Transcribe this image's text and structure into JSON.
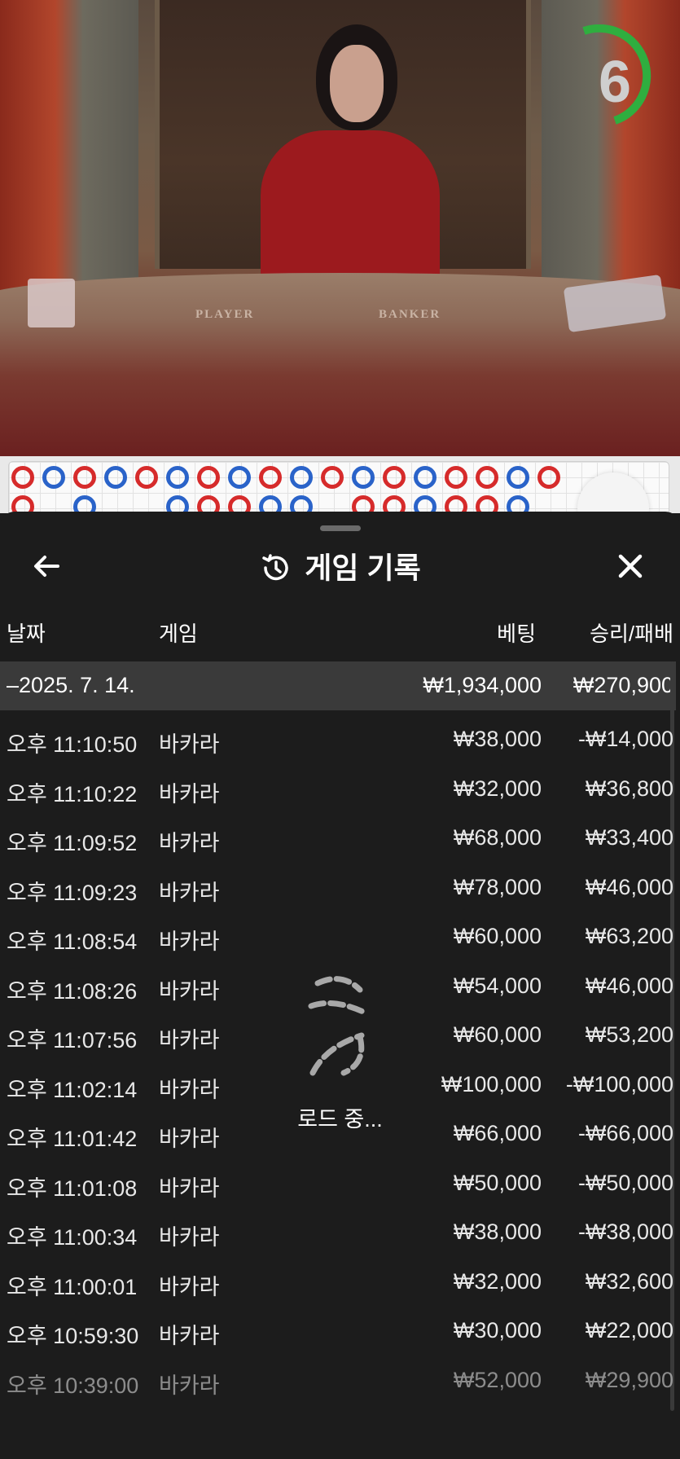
{
  "video": {
    "timer_value": "6",
    "table_labels": [
      "PLAYER",
      "BANKER"
    ]
  },
  "sheet": {
    "title": "게임 기록",
    "columns": {
      "date": "날짜",
      "game": "게임",
      "bet": "베팅",
      "win_loss": "승리/패배"
    },
    "day_summary": {
      "date": "–2025. 7. 14.",
      "bet": "₩1,934,000",
      "win_loss": "₩270,900"
    },
    "rows": [
      {
        "time": "오후 11:10:50",
        "game": "바카라",
        "bet": "₩38,000",
        "win": "-₩14,000"
      },
      {
        "time": "오후 11:10:22",
        "game": "바카라",
        "bet": "₩32,000",
        "win": "₩36,800"
      },
      {
        "time": "오후 11:09:52",
        "game": "바카라",
        "bet": "₩68,000",
        "win": "₩33,400"
      },
      {
        "time": "오후 11:09:23",
        "game": "바카라",
        "bet": "₩78,000",
        "win": "₩46,000"
      },
      {
        "time": "오후 11:08:54",
        "game": "바카라",
        "bet": "₩60,000",
        "win": "₩63,200"
      },
      {
        "time": "오후 11:08:26",
        "game": "바카라",
        "bet": "₩54,000",
        "win": "₩46,000"
      },
      {
        "time": "오후 11:07:56",
        "game": "바카라",
        "bet": "₩60,000",
        "win": "₩53,200"
      },
      {
        "time": "오후 11:02:14",
        "game": "바카라",
        "bet": "₩100,000",
        "win": "-₩100,000"
      },
      {
        "time": "오후 11:01:42",
        "game": "바카라",
        "bet": "₩66,000",
        "win": "-₩66,000"
      },
      {
        "time": "오후 11:01:08",
        "game": "바카라",
        "bet": "₩50,000",
        "win": "-₩50,000"
      },
      {
        "time": "오후 11:00:34",
        "game": "바카라",
        "bet": "₩38,000",
        "win": "-₩38,000"
      },
      {
        "time": "오후 11:00:01",
        "game": "바카라",
        "bet": "₩32,000",
        "win": "₩32,600"
      },
      {
        "time": "오후 10:59:30",
        "game": "바카라",
        "bet": "₩30,000",
        "win": "₩22,000"
      },
      {
        "time": "오후 10:39:00",
        "game": "바카라",
        "bet": "₩52,000",
        "win": "₩29,900"
      }
    ],
    "loading_text": "로드 중..."
  },
  "colors": {
    "player": "#2a63c9",
    "banker": "#d62b2b",
    "tie": "#2f9e44",
    "timer": "#2fae3f"
  },
  "icons": {
    "back": "arrow-left-icon",
    "history": "history-icon",
    "close": "close-icon",
    "up": "chevron-up-icon",
    "loader": "spinner-icon"
  }
}
